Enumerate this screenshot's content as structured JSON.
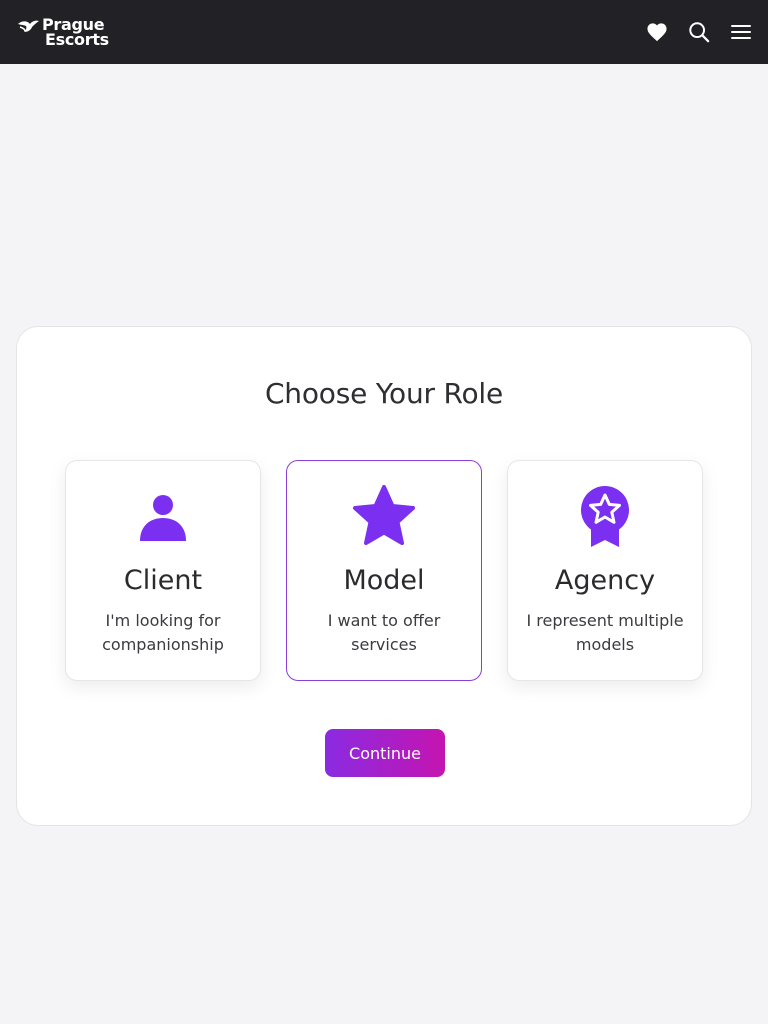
{
  "header": {
    "logo_line1": "Prague",
    "logo_line2": "Escorts",
    "icons": [
      "heart-icon",
      "search-icon",
      "menu-icon"
    ]
  },
  "main": {
    "title": "Choose Your Role",
    "roles": [
      {
        "name": "Client",
        "description": "I'm looking for companionship",
        "icon": "person-icon",
        "selected": false
      },
      {
        "name": "Model",
        "description": "I want to offer services",
        "icon": "star-icon",
        "selected": true
      },
      {
        "name": "Agency",
        "description": "I represent multiple models",
        "icon": "award-badge-icon",
        "selected": false
      }
    ],
    "continue_label": "Continue"
  },
  "colors": {
    "header_bg": "#222226",
    "accent": "#7b2ff0",
    "accent_gradient_end": "#c514b0",
    "page_bg": "#f4f4f6"
  }
}
